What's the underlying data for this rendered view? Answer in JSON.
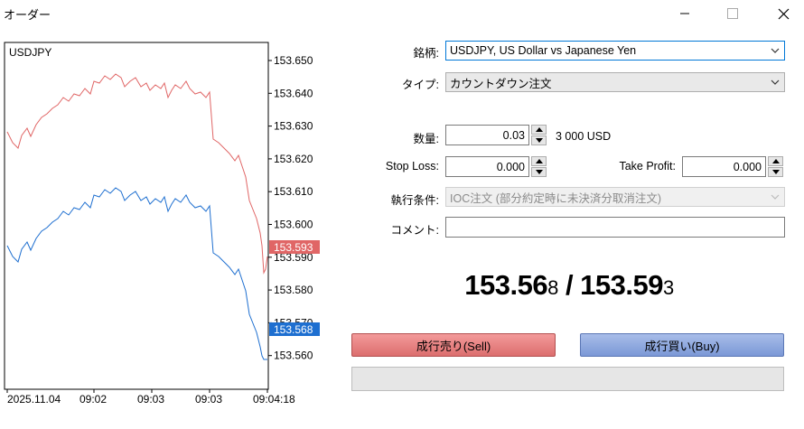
{
  "window": {
    "title": "オーダー"
  },
  "chart": {
    "symbol": "USDJPY",
    "y_ticks": [
      "153.650",
      "153.640",
      "153.630",
      "153.620",
      "153.610",
      "153.600",
      "153.590",
      "153.580",
      "153.570",
      "153.560"
    ],
    "x_ticks": [
      "2025.11.04",
      "09:02",
      "09:03",
      "09:03",
      "09:04:18"
    ],
    "ask_label": "153.593",
    "bid_label": "153.568",
    "ask_color": "#e06666",
    "bid_color": "#1e6fd0"
  },
  "form": {
    "symbol_label": "銘柄:",
    "symbol_value": "USDJPY, US Dollar vs Japanese Yen",
    "type_label": "タイプ:",
    "type_value": "カウントダウン注文",
    "volume_label": "数量:",
    "volume_value": "0.03",
    "volume_hint": "3 000 USD",
    "sl_label": "Stop Loss:",
    "sl_value": "0.000",
    "tp_label": "Take Profit:",
    "tp_value": "0.000",
    "exec_label": "執行条件:",
    "exec_value": "IOC注文 (部分約定時に未決済分取消注文)",
    "comment_label": "コメント:",
    "comment_value": ""
  },
  "quote": {
    "bid_main": "153.56",
    "bid_small": "8",
    "separator": " / ",
    "ask_main": "153.59",
    "ask_small": "3"
  },
  "buttons": {
    "sell_label": "成行売り(Sell)",
    "buy_label": "成行買い(Buy)"
  }
}
